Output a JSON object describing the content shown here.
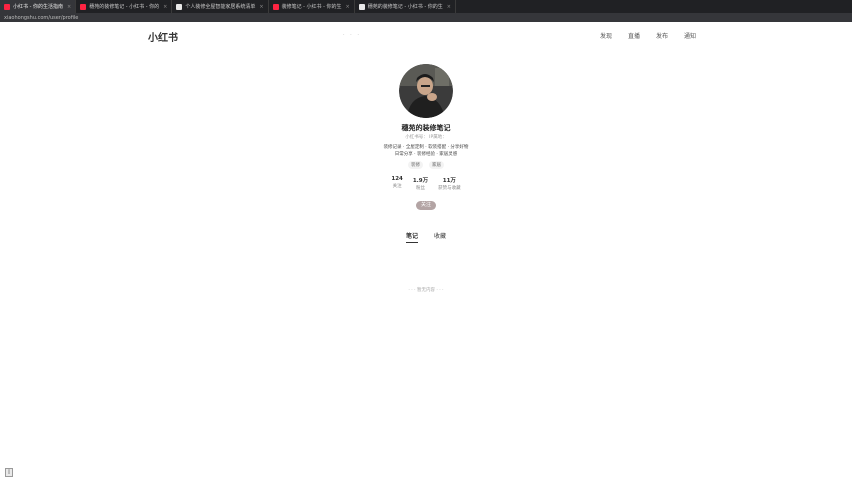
{
  "browser": {
    "tabs": [
      {
        "label": "小红书 - 你的生活指南",
        "active": true
      },
      {
        "label": "穗苑的装修笔记 - 小红书 - 你的",
        "active": false
      },
      {
        "label": "个人装修全屋智能家居系统清单",
        "active": false
      },
      {
        "label": "装修笔记 - 小红书 - 你的生",
        "active": false
      },
      {
        "label": "穗苑的装修笔记 - 小红书 - 你的生",
        "active": false
      }
    ],
    "close_glyph": "×",
    "address": "xiaohongshu.com/user/profile"
  },
  "header": {
    "logo": "小红书",
    "search_placeholder": "· · ·",
    "nav": [
      "发现",
      "直播",
      "发布",
      "通知"
    ]
  },
  "profile": {
    "name": "穗苑的装修笔记",
    "redid": "小红书号：  IP属地：",
    "bio_line1": "装修记录 · 全屋定制 · 软装搭配 · 分享好物",
    "bio_line2": "日常分享 · 装修经验 · 家居灵感",
    "tags": [
      "装修",
      "家居"
    ],
    "stats": [
      {
        "num": "124",
        "label": "关注"
      },
      {
        "num": "1.9万",
        "label": "粉丝"
      },
      {
        "num": "11万",
        "label": "获赞与收藏"
      }
    ],
    "follow_label": "关注"
  },
  "content_tabs": [
    "笔记",
    "收藏"
  ],
  "empty_message": "· · · 暂无内容 · · ·",
  "corner_icon_glyph": "▯"
}
